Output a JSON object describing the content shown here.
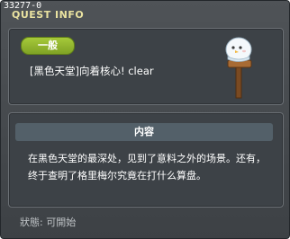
{
  "quest_id": "33277-0",
  "window_title": "QUEST INFO",
  "close_icon": "close-icon",
  "badge": {
    "label": "一般",
    "color": "#8db12c"
  },
  "quest_name": "[黑色天堂]向着核心! clear",
  "content_header": "内容",
  "description": "在黑色天堂的最深处，见到了意料之外的场景。还有，终于查明了格里梅尔究竟在打什么算盘。",
  "status": "狀態: 可開始",
  "mascot_icon": "snowman-signpost-icon"
}
